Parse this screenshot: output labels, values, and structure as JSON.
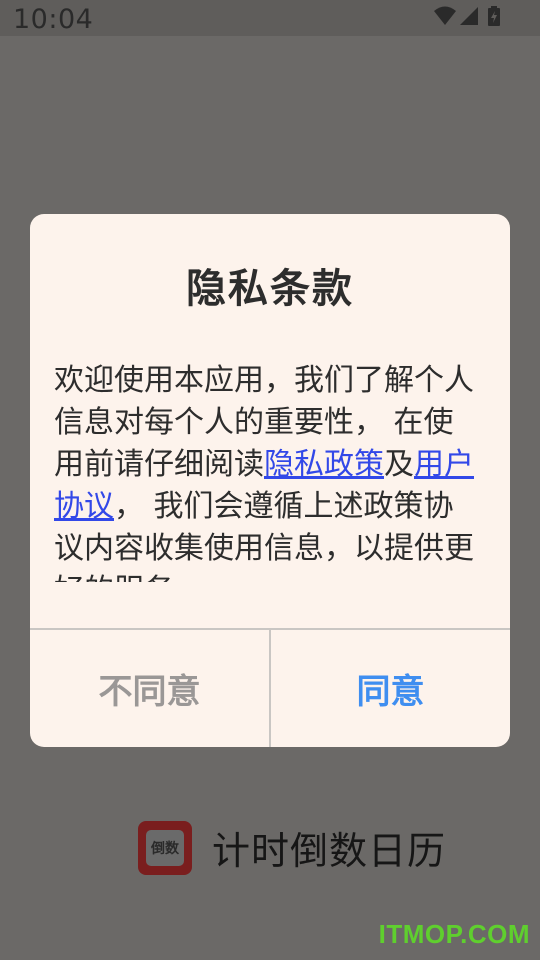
{
  "status_bar": {
    "time": "10:04",
    "icons": [
      "wifi-icon",
      "cell-signal-icon",
      "battery-icon"
    ]
  },
  "background_app": {
    "logo_icon": "countdown-calendar-logo",
    "logo_text": "倒数",
    "name": "计时倒数日历"
  },
  "watermark": "ITMOP.COM",
  "dialog": {
    "title": "隐私条款",
    "body_intro": "欢迎使用本应用，我们了解个人信息对每个人的重要性， 在使用前请仔细阅读",
    "privacy_link": "隐私政策",
    "conjunction": "及",
    "agreement_link": "用户协议",
    "body_rest": "， 我们会遵循上述政策协议内容收集使用信息，以提供更好的服务。",
    "disagree_label": "不同意",
    "agree_label": "同意"
  },
  "colors": {
    "scrim": "#6b6967",
    "dialog_bg": "#fdf3ec",
    "link": "#3248e8",
    "agree": "#3f8ef0",
    "disagree": "#9a9796",
    "watermark": "#5fcf2e"
  }
}
